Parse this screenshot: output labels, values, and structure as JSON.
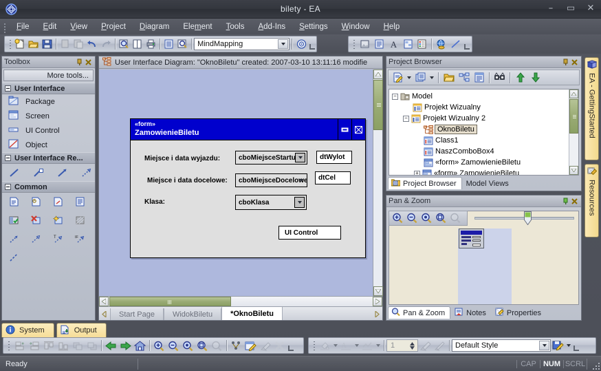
{
  "window": {
    "title": "bilety - EA",
    "app_icon": "ea-logo-icon",
    "minimize": "–",
    "maximize": "▭",
    "close": "✕"
  },
  "menubar": {
    "items": [
      {
        "label": "File",
        "mnemonic": "F"
      },
      {
        "label": "Edit",
        "mnemonic": "E"
      },
      {
        "label": "View",
        "mnemonic": "V"
      },
      {
        "label": "Project",
        "mnemonic": "P"
      },
      {
        "label": "Diagram",
        "mnemonic": "D"
      },
      {
        "label": "Element",
        "mnemonic": "m"
      },
      {
        "label": "Tools",
        "mnemonic": "T"
      },
      {
        "label": "Add-Ins",
        "mnemonic": "A"
      },
      {
        "label": "Settings",
        "mnemonic": "S"
      },
      {
        "label": "Window",
        "mnemonic": "W"
      },
      {
        "label": "Help",
        "mnemonic": "H"
      }
    ]
  },
  "toolbar": {
    "perspective_value": "MindMapping",
    "buttons": [
      "new-project-icon",
      "open-project-icon",
      "save-icon",
      "copy-icon",
      "paste-icon",
      "undo-icon",
      "redo-icon",
      "search-icon",
      "page-icon",
      "print-icon",
      "list-icon",
      "find-in-project-icon"
    ],
    "help_button": "help-icon",
    "format_buttons": [
      "image-icon",
      "note-icon",
      "text-icon",
      "matrix-icon",
      "legend-icon",
      "web-icon",
      "line-icon"
    ]
  },
  "toolbox": {
    "title": "Toolbox",
    "more_tools": "More tools...",
    "sections": [
      {
        "title": "User Interface",
        "items": [
          {
            "label": "Package",
            "icon": "package-icon"
          },
          {
            "label": "Screen",
            "icon": "screen-icon"
          },
          {
            "label": "UI Control",
            "icon": "ui-control-icon"
          },
          {
            "label": "Object",
            "icon": "object-icon"
          }
        ]
      },
      {
        "title": "User Interface Re...",
        "icons": [
          "association-icon",
          "aggregation-icon",
          "dependency-icon",
          "trace-icon"
        ]
      },
      {
        "title": "Common",
        "icons": [
          "note-icon",
          "constraint-icon",
          "note-link-icon",
          "text-icon",
          "boundary-icon",
          "diagram-gate-icon",
          "new-element-icon",
          "hyperlink-icon",
          "dependency-icon",
          "trace-icon",
          "tagged-value-icon",
          "information-flow-icon",
          "connector-icon"
        ]
      }
    ]
  },
  "diagram": {
    "caption": "User Interface Diagram: \"OknoBiletu\"   created: 2007-03-10 13:11:16  modifie",
    "caption_icon": "diagram-icon",
    "tabs": [
      {
        "label": "Start Page",
        "active": false
      },
      {
        "label": "WidokBiletu",
        "active": false
      },
      {
        "label": "*OknoBiletu",
        "active": true
      }
    ],
    "form": {
      "stereotype": "«form»",
      "name": "ZamowienieBiletu",
      "minimize_icon": "minimize-icon",
      "close_icon": "close-icon",
      "rows": [
        {
          "label": "Miejsce i data wyjazdu:",
          "combo": "cboMiejsceStartu",
          "text": "dtWylot"
        },
        {
          "label": "Miejsce i data docelowe:",
          "combo": "cboMiejsceDocelowego",
          "text": "dtCel"
        },
        {
          "label": "Klasa:",
          "combo": "cboKlasa",
          "text": ""
        }
      ],
      "button": "UI Control"
    }
  },
  "project_browser": {
    "title": "Project Browser",
    "toolbar_buttons": [
      "new-element-icon",
      "new-package-icon",
      "open-folder-icon",
      "diagram-icon",
      "properties-icon",
      "search-icon",
      "move-up-icon",
      "move-down-icon"
    ],
    "tree": [
      {
        "label": "Model",
        "icon": "model-icon",
        "depth": 0,
        "toggle": "−"
      },
      {
        "label": "Projekt Wizualny",
        "icon": "view-icon",
        "depth": 1,
        "toggle": ""
      },
      {
        "label": "Projekt Wizualny 2",
        "icon": "view-icon",
        "depth": 1,
        "toggle": "−"
      },
      {
        "label": "OknoBiletu",
        "icon": "diagram-icon",
        "depth": 2,
        "toggle": "",
        "selected": true
      },
      {
        "label": "Class1",
        "icon": "class-icon",
        "depth": 2,
        "toggle": ""
      },
      {
        "label": "NaszComboBox4",
        "icon": "class-icon",
        "depth": 2,
        "toggle": ""
      },
      {
        "label": "«form» ZamowienieBiletu",
        "icon": "screen-icon",
        "depth": 2,
        "toggle": ""
      },
      {
        "label": "«form» ZamowienieBiletu",
        "icon": "screen-icon",
        "depth": 2,
        "toggle": "+"
      }
    ],
    "tabs": [
      {
        "label": "Project Browser",
        "icon": "browser-icon",
        "active": true
      },
      {
        "label": "Model Views",
        "icon": "",
        "active": false
      }
    ]
  },
  "pan_zoom": {
    "title": "Pan & Zoom",
    "buttons": [
      "zoom-in-icon",
      "zoom-out-icon",
      "zoom-fit-icon",
      "zoom-selection-icon",
      "zoom-reset-icon"
    ],
    "slider_value": 72,
    "tabs": [
      {
        "label": "Pan & Zoom",
        "icon": "pan-zoom-icon",
        "active": true
      },
      {
        "label": "Notes",
        "icon": "notes-icon",
        "active": false
      },
      {
        "label": "Properties",
        "icon": "properties-icon",
        "active": false
      }
    ]
  },
  "vertical_tabs": [
    {
      "label": "EA - GettingStarted",
      "icon": "book-icon"
    },
    {
      "label": "Resources",
      "icon": "resources-icon"
    }
  ],
  "bottom_tabs": [
    {
      "label": "System",
      "icon": "info-icon"
    },
    {
      "label": "Output",
      "icon": "output-icon"
    }
  ],
  "bottom_toolbar": {
    "left_buttons": [
      "align-left-icon",
      "align-right-icon",
      "align-top-icon",
      "align-bottom-icon",
      "bring-front-icon",
      "send-back-icon",
      "nav-back-icon",
      "nav-forward-icon",
      "home-icon",
      "zoom-in-icon",
      "zoom-out-icon",
      "zoom-fit-icon",
      "zoom-selection-icon",
      "zoom-reset-icon",
      "auto-layout-icon",
      "edit-icon",
      "paintbrush-icon",
      "delete-icon"
    ],
    "right_buttons": [
      "fill-color-icon",
      "font-color-icon",
      "line-color-icon"
    ],
    "line_width_value": "1",
    "style_value": "Default Style",
    "save_style_icon": "save-style-icon"
  },
  "statusbar": {
    "message": "Ready",
    "indicators": [
      {
        "label": "CAP",
        "active": false
      },
      {
        "label": "NUM",
        "active": true
      },
      {
        "label": "SCRL",
        "active": false
      }
    ]
  },
  "colors": {
    "form_title_blue": "#0000cd",
    "canvas_blue": "#aeb8dd",
    "accent_gold": "#f3d98d",
    "scrollbar_green": "#9aab74"
  }
}
